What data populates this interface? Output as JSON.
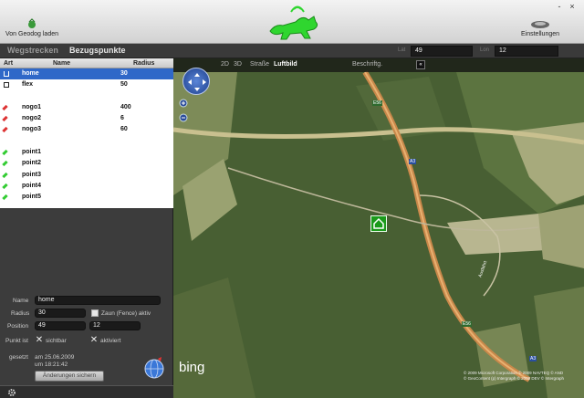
{
  "header": {
    "load_label": "Von Geodog laden",
    "settings_label": "Einstellungen",
    "window_controls": [
      "-",
      "×"
    ]
  },
  "tabs": [
    {
      "label": "Wegstrecken",
      "active": false
    },
    {
      "label": "Bezugspunkte",
      "active": true
    }
  ],
  "coords": {
    "lat_label": "Lat",
    "lat_value": "49",
    "lon_label": "Lon",
    "lon_value": "12"
  },
  "table": {
    "columns": [
      "Art",
      "Name",
      "Radius"
    ],
    "rows": [
      {
        "icon": "home-icon",
        "name": "home",
        "radius": "30",
        "selected": true
      },
      {
        "icon": "fence-icon",
        "name": "flex",
        "radius": "50",
        "selected": false
      },
      {
        "icon": "",
        "name": "",
        "radius": "",
        "selected": false
      },
      {
        "icon": "red-pin-icon",
        "name": "nogo1",
        "radius": "400",
        "selected": false
      },
      {
        "icon": "red-pin-icon",
        "name": "nogo2",
        "radius": "6",
        "selected": false
      },
      {
        "icon": "red-pin-icon",
        "name": "nogo3",
        "radius": "60",
        "selected": false
      },
      {
        "icon": "",
        "name": "",
        "radius": "",
        "selected": false
      },
      {
        "icon": "green-pin-icon",
        "name": "point1",
        "radius": "",
        "selected": false
      },
      {
        "icon": "green-pin-icon",
        "name": "point2",
        "radius": "",
        "selected": false
      },
      {
        "icon": "green-pin-icon",
        "name": "point3",
        "radius": "",
        "selected": false
      },
      {
        "icon": "green-pin-icon",
        "name": "point4",
        "radius": "",
        "selected": false
      },
      {
        "icon": "green-pin-icon",
        "name": "point5",
        "radius": "",
        "selected": false
      }
    ]
  },
  "form": {
    "name_label": "Name",
    "name_value": "home",
    "radius_label": "Radius",
    "radius_value": "30",
    "fence_label": "Zaun (Fence) aktiv",
    "position_label": "Position",
    "pos_lat": "49",
    "pos_lon": "12",
    "punkt_label": "Punkt ist",
    "visible_label": "sichtbar",
    "activated_label": "aktiviert",
    "set_label": "gesetzt",
    "set_date": "am 25.06.2009",
    "set_time": "um 18:21:42",
    "save_label": "Änderungen sichern"
  },
  "map": {
    "toolbar": [
      "2D",
      "3D",
      "Straße",
      "Luftbild",
      "Beschriftg."
    ],
    "close_label": "«",
    "bing_label": "bing",
    "road_labels": [
      "E56",
      "A3",
      "E56",
      "A3",
      "Ausfahrt"
    ],
    "copyright": [
      "© 2009 Microsoft Corporation   © 2009 NAVTEQ   © AND",
      "© GeoContent (p) Intergraph   © 2009 DEV   © Intergraph"
    ]
  },
  "colors": {
    "selection": "#2f68c8",
    "home_marker": "#1b9a1b",
    "nogo": "#d33",
    "point": "#3c3"
  }
}
